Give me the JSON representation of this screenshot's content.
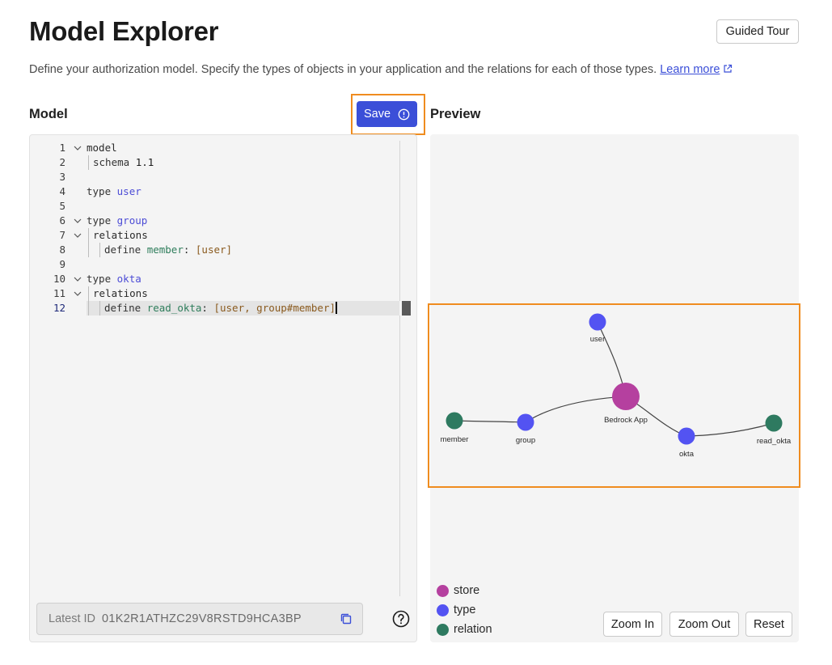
{
  "header": {
    "title": "Model Explorer",
    "guided_tour_label": "Guided Tour",
    "description": "Define your authorization model. Specify the types of objects in your application and the relations for each of those types.",
    "learn_more_label": "Learn more"
  },
  "model": {
    "section_title": "Model",
    "save_label": "Save",
    "code_lines": [
      {
        "n": "1",
        "text": "model"
      },
      {
        "n": "2",
        "text": "schema 1.1"
      },
      {
        "n": "3",
        "text": ""
      },
      {
        "n": "4",
        "text": "type user"
      },
      {
        "n": "5",
        "text": ""
      },
      {
        "n": "6",
        "text": "type group"
      },
      {
        "n": "7",
        "text": "relations"
      },
      {
        "n": "8",
        "text": "define member: [user]"
      },
      {
        "n": "9",
        "text": ""
      },
      {
        "n": "10",
        "text": "type okta"
      },
      {
        "n": "11",
        "text": "relations"
      },
      {
        "n": "12",
        "text": "define read_okta: [user, group#member]"
      }
    ],
    "latest_id_label": "Latest ID",
    "latest_id_value": "01K2R1ATHZC29V8RSTD9HCA3BP"
  },
  "preview": {
    "section_title": "Preview",
    "nodes": [
      {
        "id": "store",
        "label": "Bedrock App",
        "kind": "store"
      },
      {
        "id": "user",
        "label": "user",
        "kind": "type"
      },
      {
        "id": "group",
        "label": "group",
        "kind": "type"
      },
      {
        "id": "okta",
        "label": "okta",
        "kind": "type"
      },
      {
        "id": "member",
        "label": "member",
        "kind": "relation"
      },
      {
        "id": "read_okta",
        "label": "read_okta",
        "kind": "relation"
      }
    ],
    "legend": [
      {
        "label": "store",
        "color": "#b5409f"
      },
      {
        "label": "type",
        "color": "#5353f2"
      },
      {
        "label": "relation",
        "color": "#2e7a60"
      }
    ],
    "zoom_in_label": "Zoom In",
    "zoom_out_label": "Zoom Out",
    "reset_label": "Reset"
  },
  "colors": {
    "accent": "#3b4fd8",
    "highlight": "#ef8c1f",
    "store": "#b5409f",
    "type": "#5353f2",
    "relation": "#2e7a60"
  }
}
